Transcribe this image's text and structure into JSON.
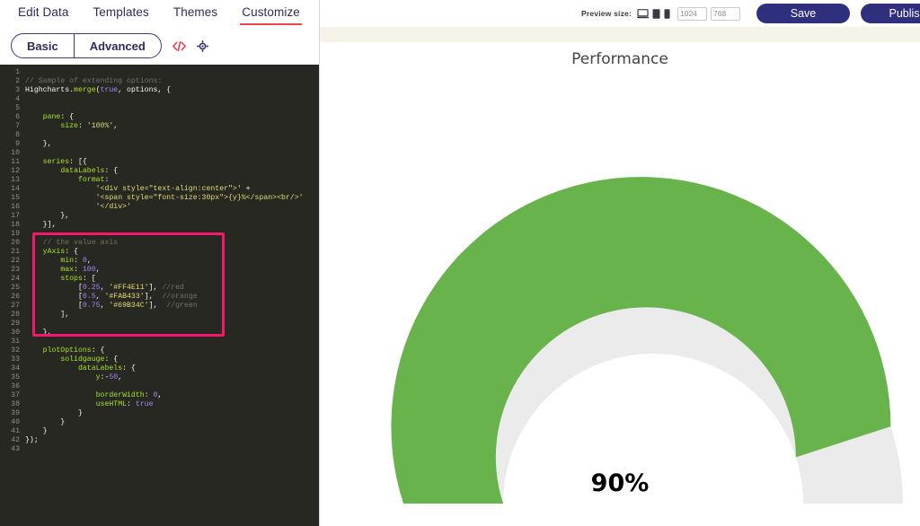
{
  "app": {
    "tabs": [
      {
        "label": "Edit Data",
        "active": false
      },
      {
        "label": "Templates",
        "active": false
      },
      {
        "label": "Themes",
        "active": false
      },
      {
        "label": "Customize",
        "active": true
      }
    ],
    "mode_toggle": {
      "basic_label": "Basic",
      "advanced_label": "Advanced",
      "code_icon": "</>",
      "settings_icon": "⚙"
    }
  },
  "toolbar": {
    "preview_size_label": "Preview size:",
    "device_icons": [
      "desktop-icon",
      "tablet-icon",
      "phone-icon"
    ],
    "width_value": "1024",
    "height_value": "768",
    "save_label": "Save",
    "publish_label": "Publish"
  },
  "editor": {
    "language": "javascript",
    "theme_background": "#272822",
    "highlight_color": "#f5186b",
    "highlight_start_line": 20,
    "highlight_end_line": 30,
    "lines": [
      {
        "n": 1,
        "tokens": []
      },
      {
        "n": 2,
        "tokens": [
          {
            "t": "// Sample of extending options:",
            "c": "c-comment"
          }
        ]
      },
      {
        "n": 3,
        "tokens": [
          {
            "t": "Highcharts.",
            "c": "c-plain"
          },
          {
            "t": "merge",
            "c": "c-fn"
          },
          {
            "t": "(",
            "c": "c-plain"
          },
          {
            "t": "true",
            "c": "c-num"
          },
          {
            "t": ", options, {",
            "c": "c-plain"
          }
        ]
      },
      {
        "n": 4,
        "tokens": []
      },
      {
        "n": 5,
        "tokens": []
      },
      {
        "n": 6,
        "tokens": [
          {
            "t": "    ",
            "c": "c-plain"
          },
          {
            "t": "pane",
            "c": "c-key"
          },
          {
            "t": ": {",
            "c": "c-plain"
          }
        ]
      },
      {
        "n": 7,
        "tokens": [
          {
            "t": "        ",
            "c": "c-plain"
          },
          {
            "t": "size",
            "c": "c-key"
          },
          {
            "t": ": ",
            "c": "c-plain"
          },
          {
            "t": "'100%'",
            "c": "c-str"
          },
          {
            "t": ",",
            "c": "c-plain"
          }
        ]
      },
      {
        "n": 8,
        "tokens": []
      },
      {
        "n": 9,
        "tokens": [
          {
            "t": "    },",
            "c": "c-plain"
          }
        ]
      },
      {
        "n": 10,
        "tokens": []
      },
      {
        "n": 11,
        "tokens": [
          {
            "t": "    ",
            "c": "c-plain"
          },
          {
            "t": "series",
            "c": "c-key"
          },
          {
            "t": ": [{",
            "c": "c-plain"
          }
        ]
      },
      {
        "n": 12,
        "tokens": [
          {
            "t": "        ",
            "c": "c-plain"
          },
          {
            "t": "dataLabels",
            "c": "c-key"
          },
          {
            "t": ": {",
            "c": "c-plain"
          }
        ]
      },
      {
        "n": 13,
        "tokens": [
          {
            "t": "            ",
            "c": "c-plain"
          },
          {
            "t": "format",
            "c": "c-key"
          },
          {
            "t": ":",
            "c": "c-plain"
          }
        ]
      },
      {
        "n": 14,
        "tokens": [
          {
            "t": "                ",
            "c": "c-plain"
          },
          {
            "t": "'<div style=\"text-align:center\">'",
            "c": "c-str"
          },
          {
            "t": " +",
            "c": "c-plain"
          }
        ]
      },
      {
        "n": 15,
        "tokens": [
          {
            "t": "                ",
            "c": "c-plain"
          },
          {
            "t": "'<span style=\"font-size:30px\">{y}%</span><br/>'",
            "c": "c-str"
          }
        ]
      },
      {
        "n": 16,
        "tokens": [
          {
            "t": "                ",
            "c": "c-plain"
          },
          {
            "t": "'</div>'",
            "c": "c-str"
          }
        ]
      },
      {
        "n": 17,
        "tokens": [
          {
            "t": "        },",
            "c": "c-plain"
          }
        ]
      },
      {
        "n": 18,
        "tokens": [
          {
            "t": "    }],",
            "c": "c-plain"
          }
        ]
      },
      {
        "n": 19,
        "tokens": []
      },
      {
        "n": 20,
        "tokens": [
          {
            "t": "    ",
            "c": "c-plain"
          },
          {
            "t": "// the value axis",
            "c": "c-comment"
          }
        ]
      },
      {
        "n": 21,
        "tokens": [
          {
            "t": "    ",
            "c": "c-plain"
          },
          {
            "t": "yAxis",
            "c": "c-key"
          },
          {
            "t": ": {",
            "c": "c-plain"
          }
        ]
      },
      {
        "n": 22,
        "tokens": [
          {
            "t": "        ",
            "c": "c-plain"
          },
          {
            "t": "min",
            "c": "c-key"
          },
          {
            "t": ": ",
            "c": "c-plain"
          },
          {
            "t": "0",
            "c": "c-num"
          },
          {
            "t": ",",
            "c": "c-plain"
          }
        ]
      },
      {
        "n": 23,
        "tokens": [
          {
            "t": "        ",
            "c": "c-plain"
          },
          {
            "t": "max",
            "c": "c-key"
          },
          {
            "t": ": ",
            "c": "c-plain"
          },
          {
            "t": "100",
            "c": "c-num"
          },
          {
            "t": ",",
            "c": "c-plain"
          }
        ]
      },
      {
        "n": 24,
        "tokens": [
          {
            "t": "        ",
            "c": "c-plain"
          },
          {
            "t": "stops",
            "c": "c-key"
          },
          {
            "t": ": [",
            "c": "c-plain"
          }
        ]
      },
      {
        "n": 25,
        "tokens": [
          {
            "t": "            [",
            "c": "c-plain"
          },
          {
            "t": "0.25",
            "c": "c-num"
          },
          {
            "t": ", ",
            "c": "c-plain"
          },
          {
            "t": "'#FF4E11'",
            "c": "c-str"
          },
          {
            "t": "], ",
            "c": "c-plain"
          },
          {
            "t": "//red",
            "c": "c-comment"
          }
        ]
      },
      {
        "n": 26,
        "tokens": [
          {
            "t": "            [",
            "c": "c-plain"
          },
          {
            "t": "0.5",
            "c": "c-num"
          },
          {
            "t": ", ",
            "c": "c-plain"
          },
          {
            "t": "'#FAB433'",
            "c": "c-str"
          },
          {
            "t": "],  ",
            "c": "c-plain"
          },
          {
            "t": "//orange",
            "c": "c-comment"
          }
        ]
      },
      {
        "n": 27,
        "tokens": [
          {
            "t": "            [",
            "c": "c-plain"
          },
          {
            "t": "0.75",
            "c": "c-num"
          },
          {
            "t": ", ",
            "c": "c-plain"
          },
          {
            "t": "'#69B34C'",
            "c": "c-str"
          },
          {
            "t": "],  ",
            "c": "c-plain"
          },
          {
            "t": "//green",
            "c": "c-comment"
          }
        ]
      },
      {
        "n": 28,
        "tokens": [
          {
            "t": "        ],",
            "c": "c-plain"
          }
        ]
      },
      {
        "n": 29,
        "tokens": []
      },
      {
        "n": 30,
        "tokens": [
          {
            "t": "    },",
            "c": "c-plain"
          }
        ]
      },
      {
        "n": 31,
        "tokens": []
      },
      {
        "n": 32,
        "tokens": [
          {
            "t": "    ",
            "c": "c-plain"
          },
          {
            "t": "plotOptions",
            "c": "c-key"
          },
          {
            "t": ": {",
            "c": "c-plain"
          }
        ]
      },
      {
        "n": 33,
        "tokens": [
          {
            "t": "        ",
            "c": "c-plain"
          },
          {
            "t": "solidgauge",
            "c": "c-key"
          },
          {
            "t": ": {",
            "c": "c-plain"
          }
        ]
      },
      {
        "n": 34,
        "tokens": [
          {
            "t": "            ",
            "c": "c-plain"
          },
          {
            "t": "dataLabels",
            "c": "c-key"
          },
          {
            "t": ": {",
            "c": "c-plain"
          }
        ]
      },
      {
        "n": 35,
        "tokens": [
          {
            "t": "                ",
            "c": "c-plain"
          },
          {
            "t": "y",
            "c": "c-key"
          },
          {
            "t": ":-",
            "c": "c-plain"
          },
          {
            "t": "50",
            "c": "c-num"
          },
          {
            "t": ",",
            "c": "c-plain"
          }
        ]
      },
      {
        "n": 36,
        "tokens": []
      },
      {
        "n": 37,
        "tokens": [
          {
            "t": "                ",
            "c": "c-plain"
          },
          {
            "t": "borderWidth",
            "c": "c-key"
          },
          {
            "t": ": ",
            "c": "c-plain"
          },
          {
            "t": "0",
            "c": "c-num"
          },
          {
            "t": ",",
            "c": "c-plain"
          }
        ]
      },
      {
        "n": 38,
        "tokens": [
          {
            "t": "                ",
            "c": "c-plain"
          },
          {
            "t": "useHTML",
            "c": "c-key"
          },
          {
            "t": ": ",
            "c": "c-plain"
          },
          {
            "t": "true",
            "c": "c-num"
          }
        ]
      },
      {
        "n": 39,
        "tokens": [
          {
            "t": "            }",
            "c": "c-plain"
          }
        ]
      },
      {
        "n": 40,
        "tokens": [
          {
            "t": "        }",
            "c": "c-plain"
          }
        ]
      },
      {
        "n": 41,
        "tokens": [
          {
            "t": "    }",
            "c": "c-plain"
          }
        ]
      },
      {
        "n": 42,
        "tokens": [
          {
            "t": "});",
            "c": "c-plain"
          }
        ]
      },
      {
        "n": 43,
        "tokens": []
      }
    ]
  },
  "chart_data": {
    "type": "gauge",
    "title": "Performance",
    "value": 90,
    "value_label": "90%",
    "min": 0,
    "max": 100,
    "unit": "%",
    "gauge_style": "solidgauge-semicircle",
    "start_angle": -90,
    "end_angle": 90,
    "filled_color": "#69B34C",
    "track_color": "#ebebeb",
    "background": "#ffffff",
    "stops": [
      {
        "position": 0.25,
        "color": "#FF4E11",
        "name": "red"
      },
      {
        "position": 0.5,
        "color": "#FAB433",
        "name": "orange"
      },
      {
        "position": 0.75,
        "color": "#69B34C",
        "name": "green"
      }
    ]
  }
}
